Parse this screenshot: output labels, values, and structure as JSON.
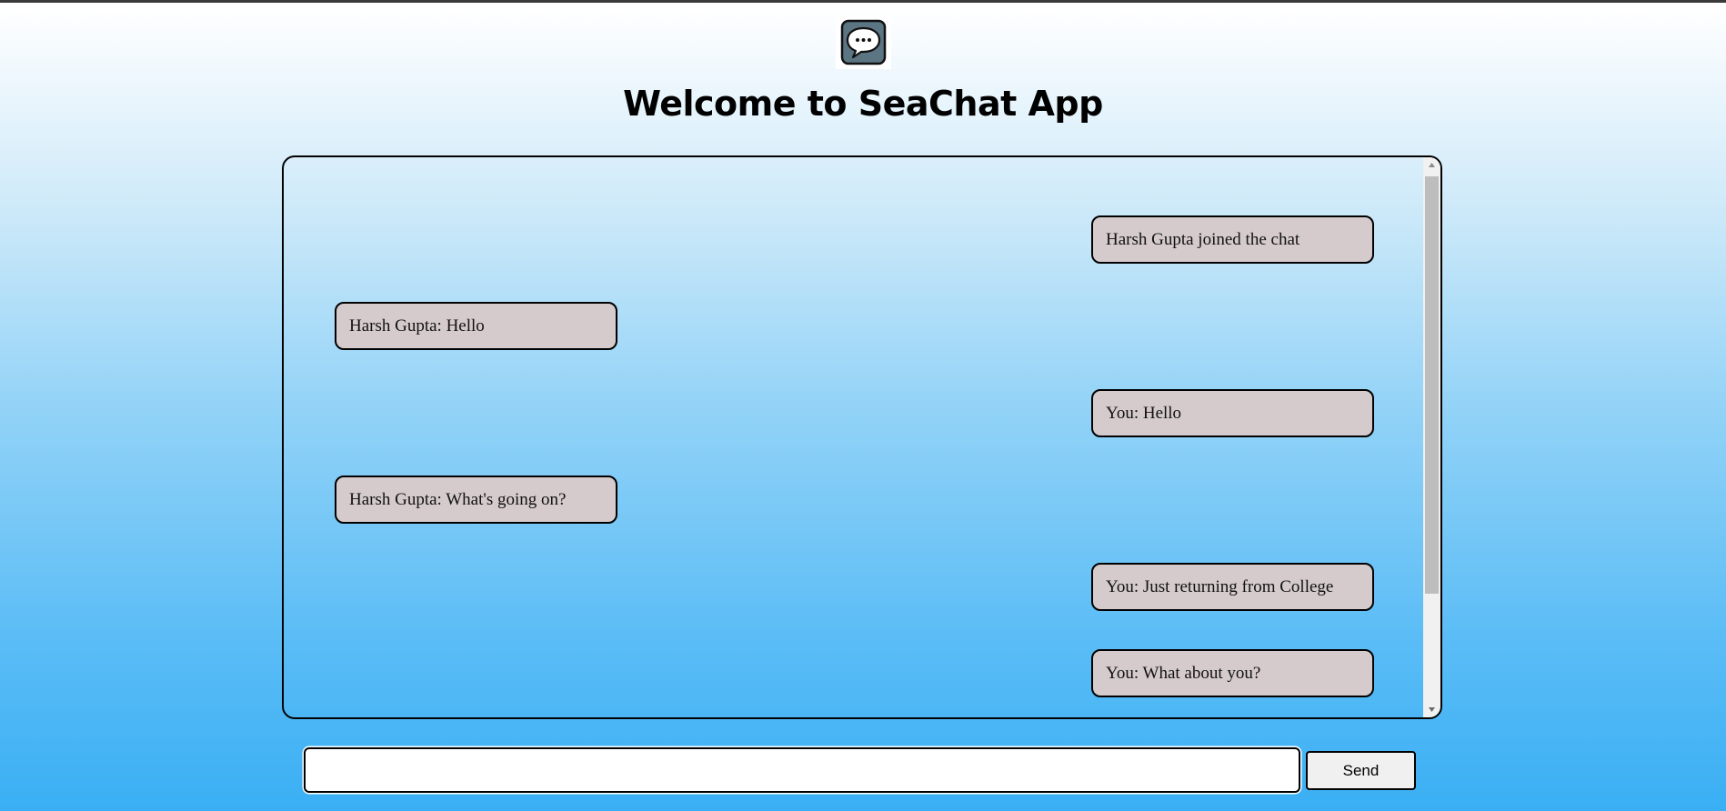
{
  "app": {
    "title": "Welcome to SeaChat App",
    "logo_icon": "chat-bubble-icon"
  },
  "messages": [
    {
      "text": "Harsh Gupta joined the chat",
      "side": "right"
    },
    {
      "text": "Harsh Gupta: Hello",
      "side": "left"
    },
    {
      "text": "You: Hello",
      "side": "right"
    },
    {
      "text": "Harsh Gupta: What's going on?",
      "side": "left"
    },
    {
      "text": "You: Just returning from College",
      "side": "right"
    },
    {
      "text": "You: What about you?",
      "side": "right"
    }
  ],
  "composer": {
    "input_value": "",
    "input_placeholder": "",
    "send_label": "Send"
  },
  "colors": {
    "bubble": "#d5cbcc",
    "gradient_top": "#ffffff",
    "gradient_bottom": "#3aaff4"
  }
}
